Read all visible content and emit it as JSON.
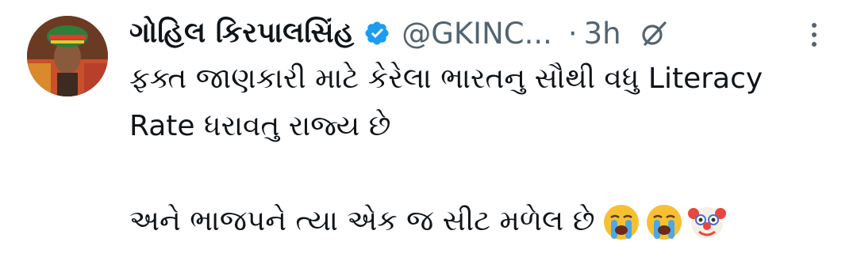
{
  "tweet": {
    "author": {
      "display_name": "ગોહિલ કિરપાલસિંહ",
      "handle": "@GKINC...",
      "verified": true,
      "avatar_icon": "profile-photo"
    },
    "separator": "·",
    "time": "3h",
    "text_line_1": "ફક્ત જાણકારી માટે કેરેલા ભારતનુ સૌથી વધુ Literacy",
    "text_line_2": "Rate ધરાવતુ રાજ્ય છે",
    "text_line_3": "અને ભાજપને ત્યા એક જ સીટ મળેલ છે",
    "emojis": [
      "loudly-crying-face",
      "loudly-crying-face",
      "clown-face"
    ],
    "icons": {
      "verified": "verified-badge-icon",
      "grok": "grok-icon",
      "more": "more-vertical-icon"
    },
    "colors": {
      "verified_blue": "#1d9bf0",
      "secondary_text": "#536471",
      "primary_text": "#0f1419"
    }
  }
}
